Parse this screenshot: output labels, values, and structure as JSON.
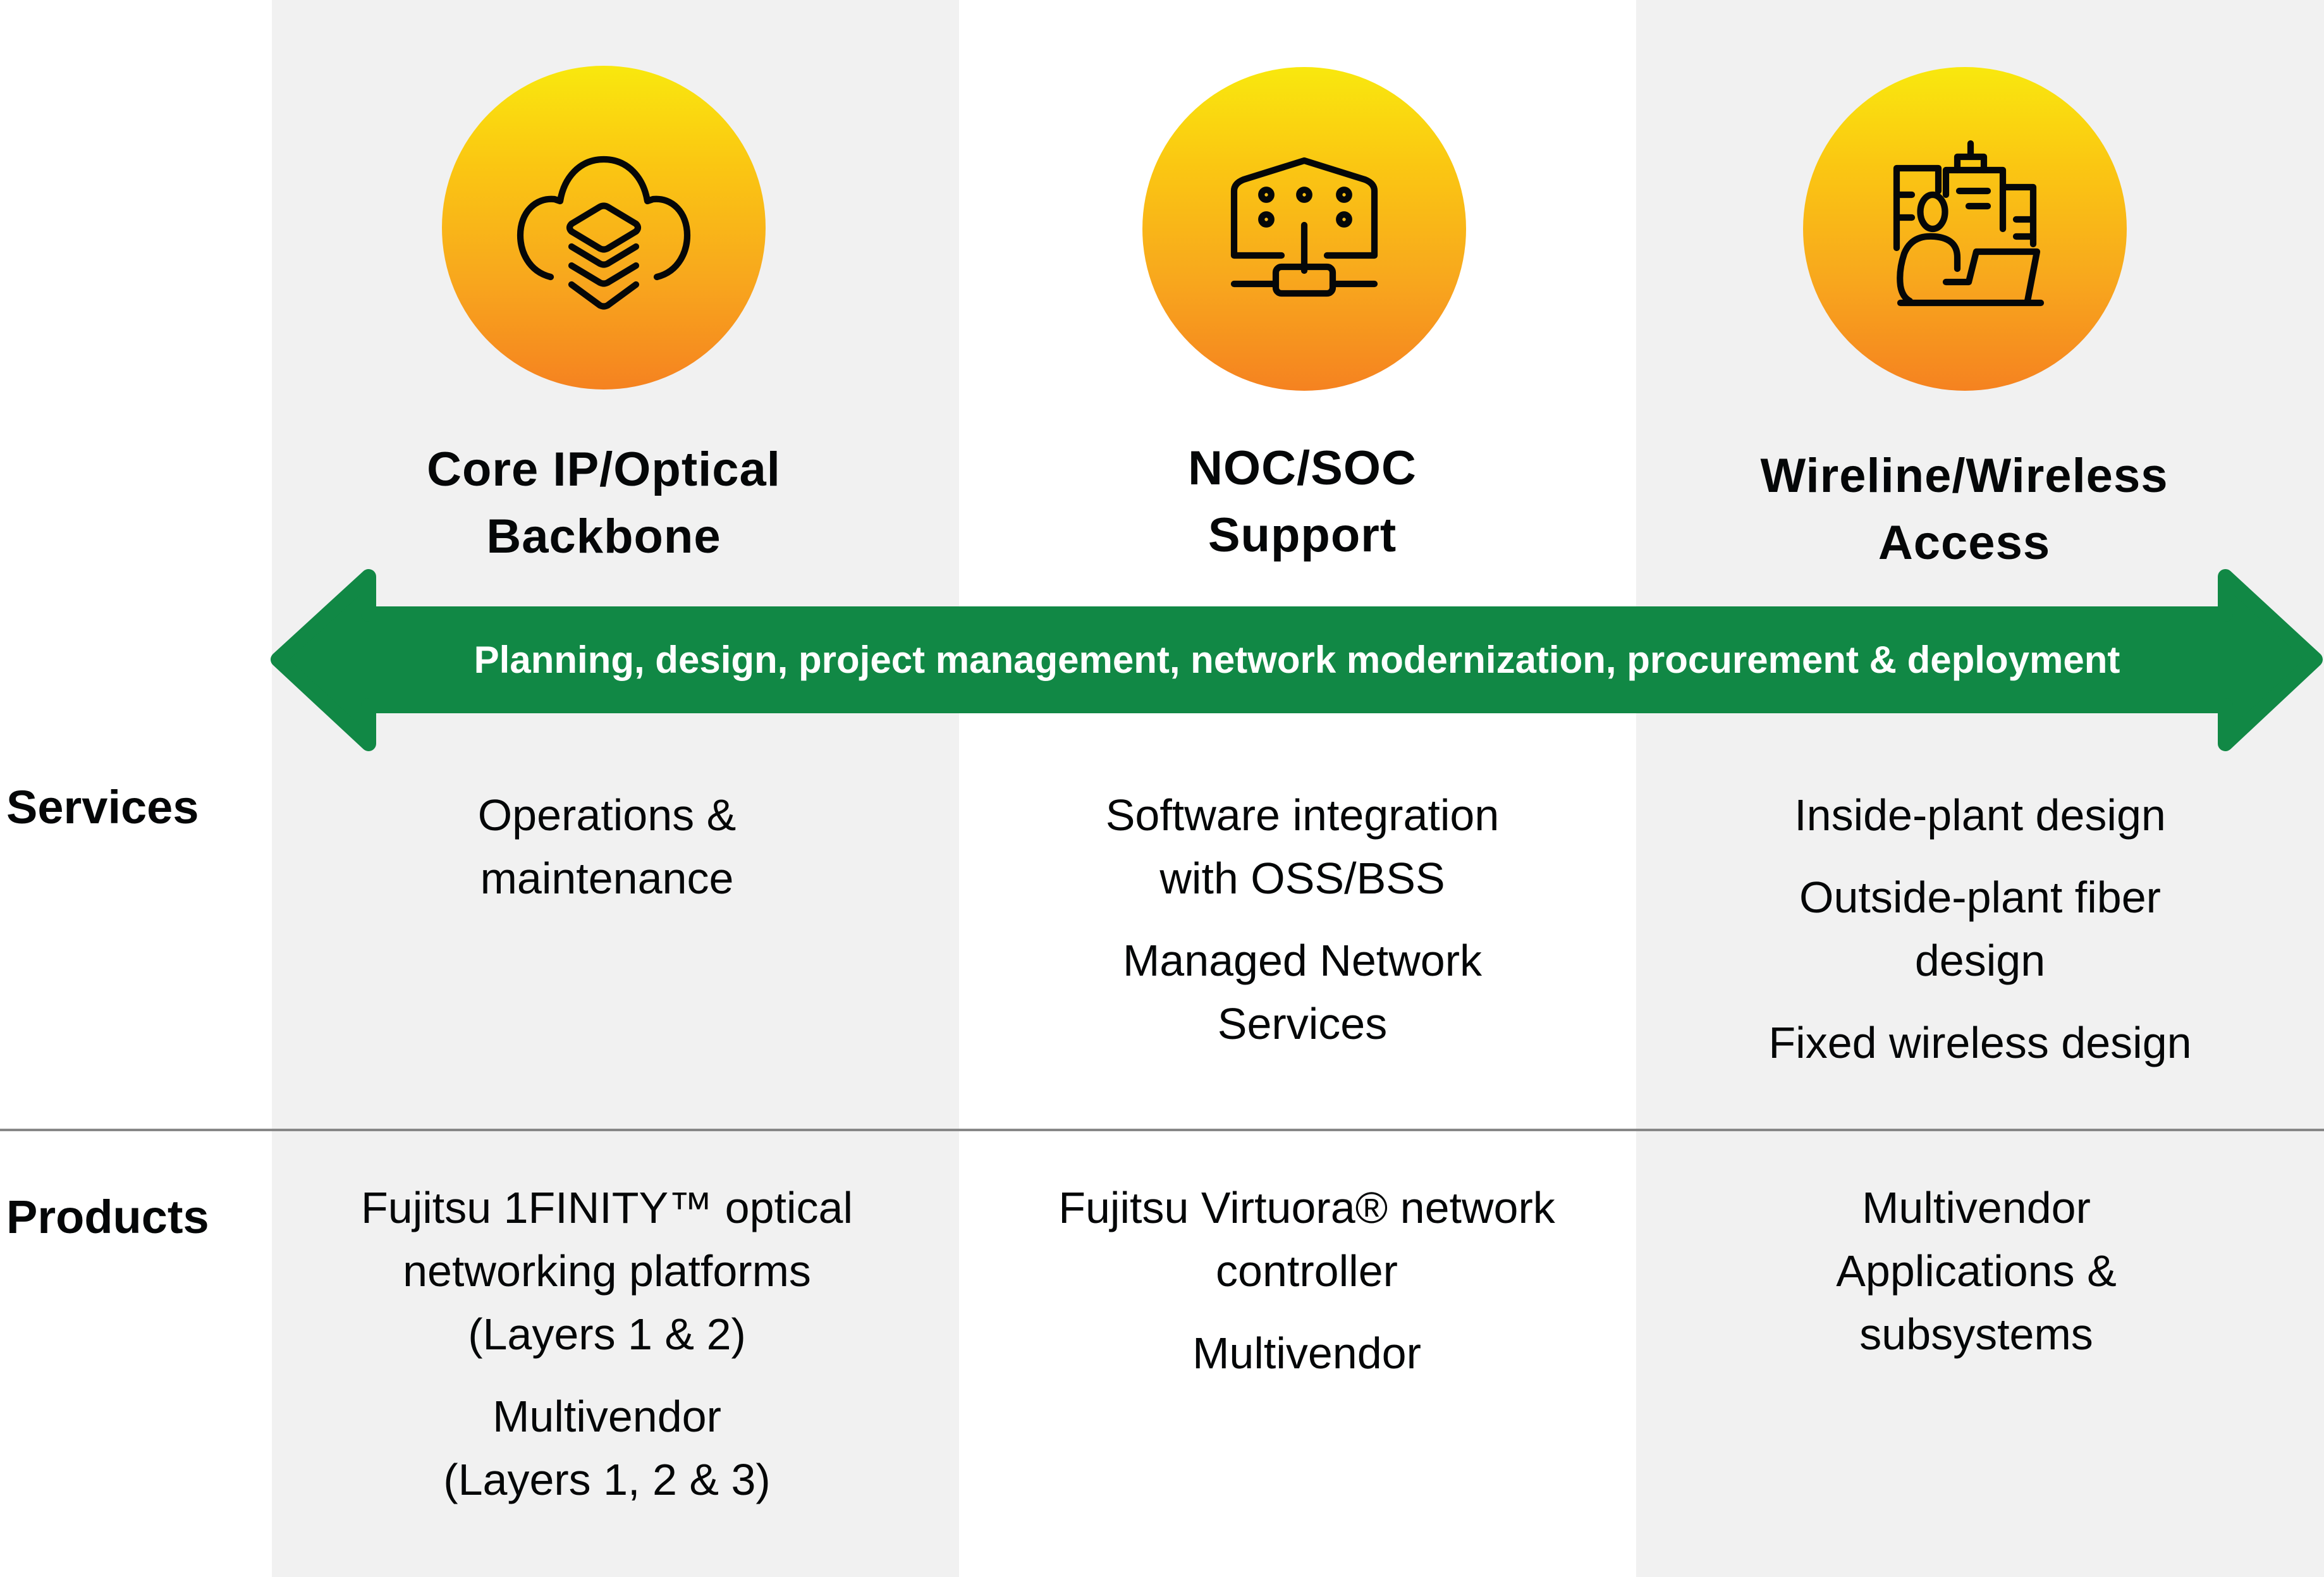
{
  "colors": {
    "arrow_green": "#118845",
    "column_gray": "#f1f1f1",
    "circle_gradient_top": "#f9e80e",
    "circle_gradient_bottom": "#f58220",
    "divider": "#878787",
    "text": "#050708"
  },
  "columns": [
    {
      "icon": "cloud-layers-icon",
      "heading_lines": [
        "Core IP/Optical",
        "Backbone"
      ],
      "services": [
        [
          "Operations &",
          "maintenance"
        ]
      ],
      "products": [
        [
          "Fujitsu 1FINITY™ optical",
          "networking platforms",
          "(Layers 1 & 2)"
        ],
        [
          "Multivendor",
          "(Layers 1, 2 & 3)"
        ]
      ]
    },
    {
      "icon": "network-operations-center-icon",
      "heading_lines": [
        "NOC/SOC",
        "Support"
      ],
      "services": [
        [
          "Software integration",
          "with OSS/BSS"
        ],
        [
          "Managed Network",
          "Services"
        ]
      ],
      "products": [
        [
          "Fujitsu Virtuora® network",
          "controller"
        ],
        [
          "Multivendor"
        ]
      ]
    },
    {
      "icon": "person-laptop-buildings-icon",
      "heading_lines": [
        "Wireline/Wireless",
        "Access"
      ],
      "services": [
        [
          "Inside-plant design"
        ],
        [
          "Outside-plant fiber",
          "design"
        ],
        [
          "Fixed wireless design"
        ]
      ],
      "products": [
        [
          "Multivendor",
          "Applications &",
          "subsystems"
        ]
      ]
    }
  ],
  "arrow": {
    "label": "Planning, design, project management, network modernization, procurement & deployment",
    "direction": "bidirectional"
  },
  "row_labels": {
    "services": "Services",
    "products": "Products"
  }
}
